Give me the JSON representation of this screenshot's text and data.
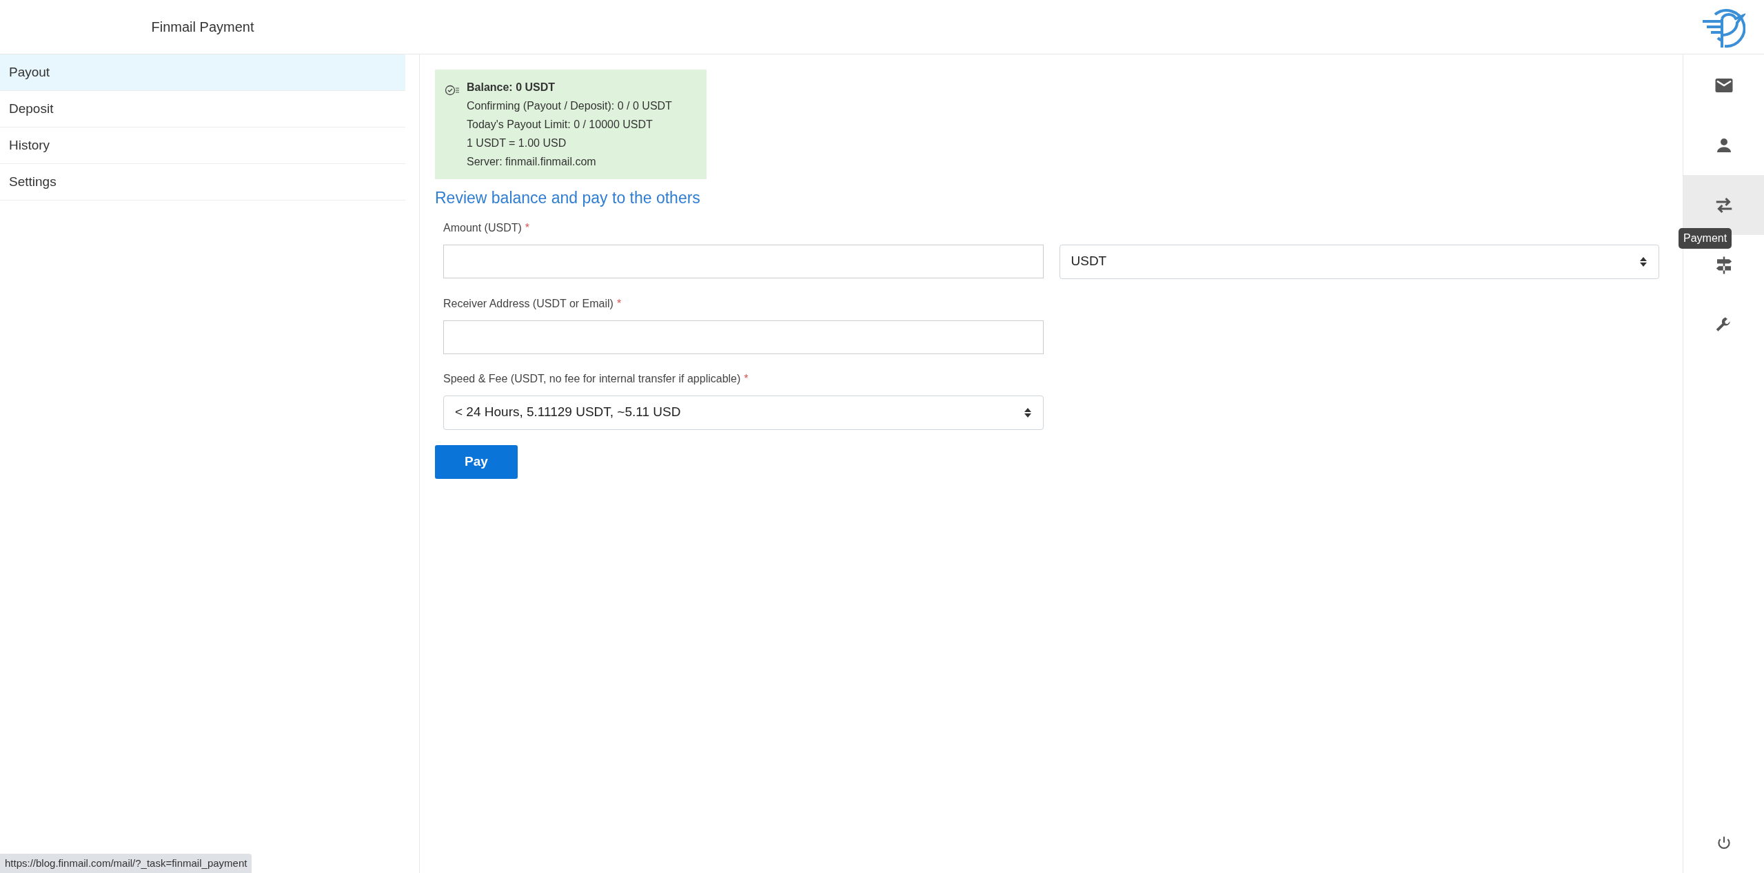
{
  "header": {
    "title": "Finmail Payment"
  },
  "sidebar": {
    "items": [
      {
        "label": "Payout",
        "selected": true
      },
      {
        "label": "Deposit",
        "selected": false
      },
      {
        "label": "History",
        "selected": false
      },
      {
        "label": "Settings",
        "selected": false
      }
    ]
  },
  "info_box": {
    "lines": [
      "**Balance: 0 USDT**",
      "Confirming (Payout / Deposit): 0 / 0 USDT",
      "Today's Payout Limit: 0 / 10000 USDT",
      "1 USDT = 1.00 USD",
      "Server: finmail.finmail.com"
    ]
  },
  "heading": "Review balance and pay to the others",
  "form": {
    "rows": [
      {
        "label": "Amount (USDT)",
        "required_mark": "*",
        "fields": [
          {
            "kind": "input"
          },
          {
            "kind": "select",
            "value": "USDT"
          }
        ]
      },
      {
        "label": "Receiver Address (USDT or Email)",
        "required_mark": "*",
        "fields": [
          {
            "kind": "input"
          }
        ]
      },
      {
        "label": "Speed & Fee (USDT, no fee for internal transfer if applicable)",
        "required_mark": "*",
        "fields": [
          {
            "kind": "select",
            "value": "< 24 Hours, 5.11129 USDT, ~5.11 USD"
          }
        ]
      }
    ],
    "submit": "Pay"
  },
  "rail": {
    "items": [
      {
        "kind": "mail",
        "selected": false
      },
      {
        "kind": "person",
        "selected": false
      },
      {
        "kind": "transfer",
        "selected": true
      },
      {
        "kind": "signpost",
        "selected": false
      },
      {
        "kind": "wrench",
        "selected": false
      }
    ],
    "tooltip": "Payment",
    "bottom": {
      "kind": "power"
    }
  },
  "status_url": "https://blog.finmail.com/mail/?_task=finmail_payment"
}
